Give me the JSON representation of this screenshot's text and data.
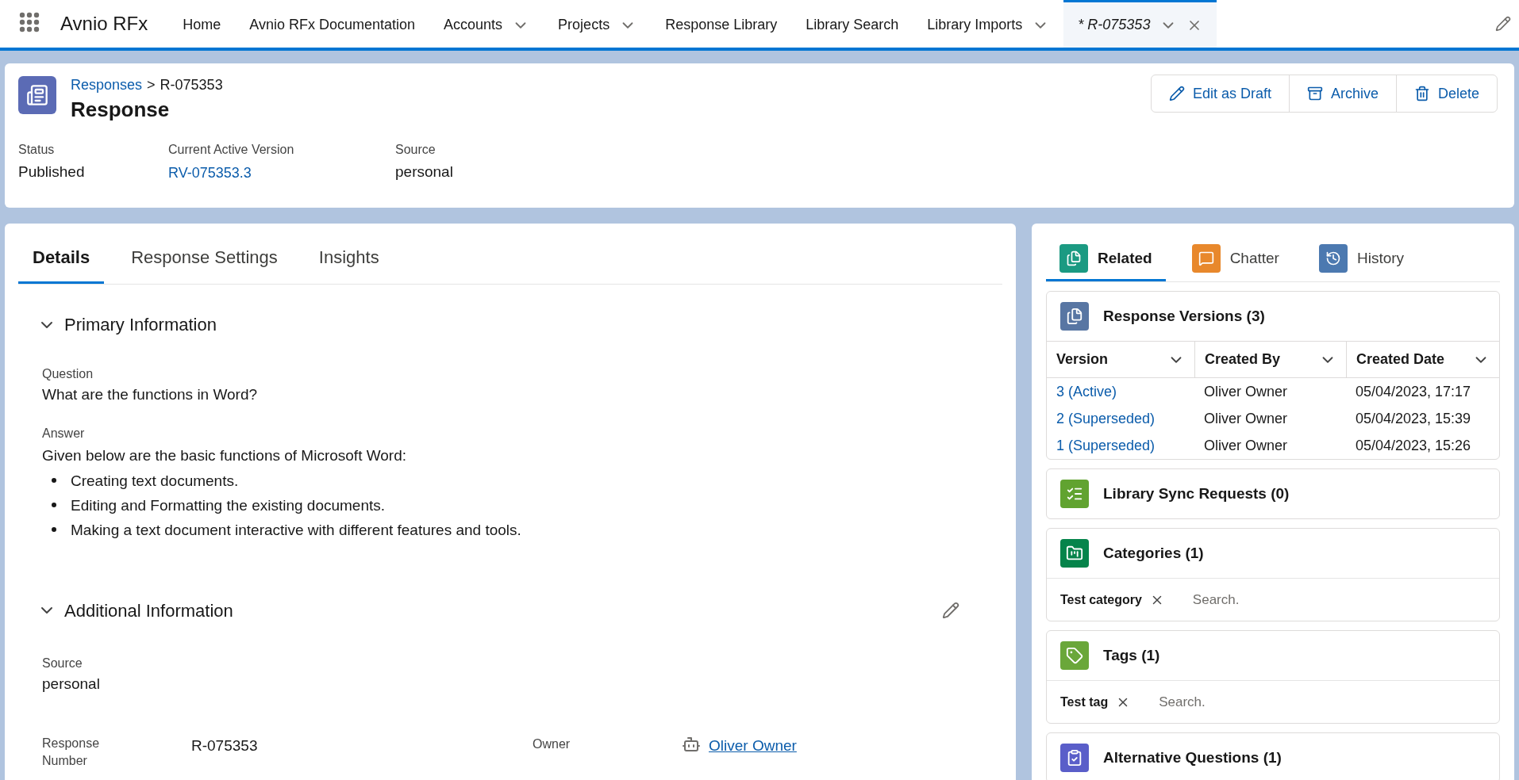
{
  "app": {
    "name": "Avnio RFx"
  },
  "nav": [
    {
      "label": "Home",
      "dropdown": false,
      "selected": false,
      "italic": false
    },
    {
      "label": "Avnio RFx Documentation",
      "dropdown": false,
      "selected": false,
      "italic": false
    },
    {
      "label": "Accounts",
      "dropdown": true,
      "selected": false,
      "italic": false
    },
    {
      "label": "Projects",
      "dropdown": true,
      "selected": false,
      "italic": false
    },
    {
      "label": "Response Library",
      "dropdown": false,
      "selected": false,
      "italic": false
    },
    {
      "label": "Library Search",
      "dropdown": false,
      "selected": false,
      "italic": false
    },
    {
      "label": "Library Imports",
      "dropdown": true,
      "selected": false,
      "italic": false
    },
    {
      "label": "* R-075353",
      "dropdown": true,
      "selected": true,
      "italic": true
    }
  ],
  "header": {
    "breadcrumb": {
      "parent": "Responses",
      "separator": ">",
      "current": "R-075353"
    },
    "title": "Response",
    "actions": [
      {
        "label": "Edit as Draft",
        "kind": "edit"
      },
      {
        "label": "Archive",
        "kind": "archive"
      },
      {
        "label": "Delete",
        "kind": "delete"
      }
    ],
    "fields": [
      {
        "label": "Status",
        "value": "Published",
        "link": false
      },
      {
        "label": "Current Active Version",
        "value": "RV-075353.3",
        "link": true
      },
      {
        "label": "Source",
        "value": "personal",
        "link": false
      }
    ]
  },
  "detail_tabs": [
    {
      "label": "Details",
      "selected": true
    },
    {
      "label": "Response Settings",
      "selected": false
    },
    {
      "label": "Insights",
      "selected": false
    }
  ],
  "primary": {
    "title": "Primary Information",
    "expanded": true,
    "question_label": "Question",
    "question": "What are the functions in Word?",
    "answer_label": "Answer",
    "answer_intro": "Given below are the basic functions of Microsoft Word:",
    "answer_bullets": [
      "Creating text documents.",
      "Editing and Formatting the existing documents.",
      "Making a text document interactive with different features and tools."
    ]
  },
  "additional": {
    "title": "Additional Information",
    "expanded": true,
    "source_label": "Source",
    "source": "personal",
    "number_label": "Response Number",
    "number": "R-075353",
    "owner_label": "Owner",
    "owner": "Oliver Owner"
  },
  "related_tabs": [
    {
      "label": "Related",
      "selected": true,
      "kind": "related",
      "color": "#1b9a82"
    },
    {
      "label": "Chatter",
      "selected": false,
      "kind": "chatter",
      "color": "#e8882c"
    },
    {
      "label": "History",
      "selected": false,
      "kind": "history",
      "color": "#4c79b0"
    }
  ],
  "versions": {
    "title": "Response Versions (3)",
    "color": "#5876a3",
    "columns": [
      "Version",
      "Created By",
      "Created Date"
    ],
    "rows": [
      [
        "3 (Active)",
        "Oliver Owner",
        "05/04/2023, 17:17"
      ],
      [
        "2 (Superseded)",
        "Oliver Owner",
        "05/04/2023, 15:39"
      ],
      [
        "1 (Superseded)",
        "Oliver Owner",
        "05/04/2023, 15:26"
      ]
    ]
  },
  "sync": {
    "title": "Library Sync Requests (0)",
    "color": "#61a330"
  },
  "categories": {
    "title": "Categories (1)",
    "color": "#06844b",
    "pills": [
      "Test category"
    ],
    "placeholder": "Search."
  },
  "tags": {
    "title": "Tags (1)",
    "color": "#6aa73a",
    "pills": [
      "Test tag"
    ],
    "placeholder": "Search."
  },
  "alternatives": {
    "title": "Alternative Questions (1)",
    "color": "#5a5ec9"
  }
}
